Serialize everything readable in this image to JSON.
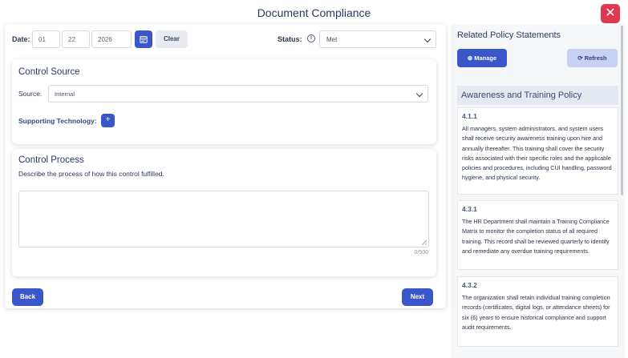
{
  "header": {
    "title": "Document Compliance",
    "close_label": "✕"
  },
  "form": {
    "date_label": "Date:",
    "date": {
      "month": "01",
      "day": "22",
      "year": "2026"
    },
    "clear_label": "Clear",
    "status_label": "Status:",
    "status_value": "Met",
    "info_glyph": "i"
  },
  "control_source": {
    "title": "Control Source",
    "source_label": "Source:",
    "source_value": "Internal",
    "supporting_label": "Supporting Technology:",
    "add_label": "+"
  },
  "control_process": {
    "title": "Control Process",
    "description": "Describe the process of how this control fulfilled.",
    "textarea_value": "",
    "counter": "0/500"
  },
  "nav": {
    "back_label": "Back",
    "next_label": "Next"
  },
  "related": {
    "title": "Related Policy Statements",
    "manage_label": "⊕ Manage",
    "refresh_label": "⟳ Refresh",
    "policy_name": "Awareness and Training Policy",
    "statements": [
      {
        "num": "4.1.1",
        "text": "All managers, system administrators, and system users shall receive security awareness training upon hire and annually thereafter. This training shall cover the security risks associated with their specific roles and the applicable policies and procedures, including CUI handling, password hygiene, and physical security."
      },
      {
        "num": "4.3.1",
        "text": "The HR Department shall maintain a Training Compliance Matrix to monitor the completion status of all required training. This record shall be reviewed quarterly to identify and remediate any overdue training requirements."
      },
      {
        "num": "4.3.2",
        "text": "The organization shall retain individual training completion records (certificates, digital logs, or attendance sheets) for six (6) years to ensure historical compliance and support audit requirements."
      }
    ]
  },
  "colors": {
    "primary": "#3b56c9",
    "danger": "#e0394f",
    "refresh_bg": "#c8d1f3",
    "policy_header_bg": "#e4e9f2"
  }
}
